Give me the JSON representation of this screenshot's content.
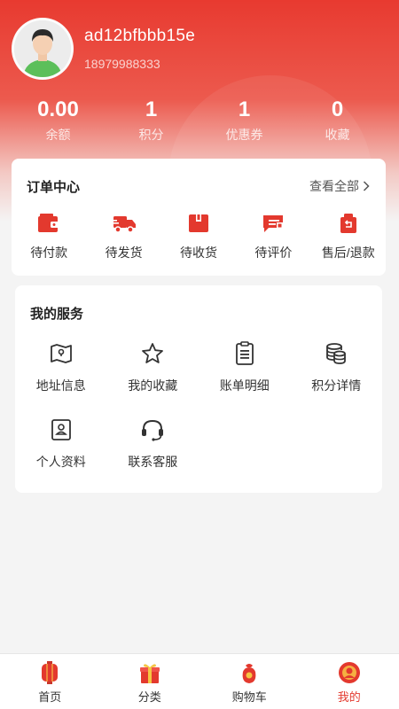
{
  "profile": {
    "username": "ad12bfbbb15e",
    "phone": "18979988333"
  },
  "stats": [
    {
      "value": "0.00",
      "label": "余额"
    },
    {
      "value": "1",
      "label": "积分"
    },
    {
      "value": "1",
      "label": "优惠券"
    },
    {
      "value": "0",
      "label": "收藏"
    }
  ],
  "orders": {
    "title": "订单中心",
    "view_all": "查看全部",
    "items": [
      {
        "label": "待付款",
        "icon": "wallet-icon"
      },
      {
        "label": "待发货",
        "icon": "delivery-truck-icon"
      },
      {
        "label": "待收货",
        "icon": "package-box-icon"
      },
      {
        "label": "待评价",
        "icon": "review-card-icon"
      },
      {
        "label": "售后/退款",
        "icon": "refund-bag-icon"
      }
    ]
  },
  "services": {
    "title": "我的服务",
    "items": [
      {
        "label": "地址信息",
        "icon": "map-icon"
      },
      {
        "label": "我的收藏",
        "icon": "star-icon"
      },
      {
        "label": "账单明细",
        "icon": "clipboard-icon"
      },
      {
        "label": "积分详情",
        "icon": "coins-icon"
      },
      {
        "label": "个人资料",
        "icon": "id-card-icon"
      },
      {
        "label": "联系客服",
        "icon": "headset-icon"
      }
    ]
  },
  "tabbar": {
    "active": "我的",
    "items": [
      {
        "label": "首页",
        "icon": "home-lantern-icon"
      },
      {
        "label": "分类",
        "icon": "gift-box-icon"
      },
      {
        "label": "购物车",
        "icon": "shopping-bag-icon"
      },
      {
        "label": "我的",
        "icon": "user-avatar-icon"
      }
    ]
  },
  "colors": {
    "brand_red": "#e83a30",
    "active_tab": "#e3392e",
    "background": "#f4f4f4"
  }
}
